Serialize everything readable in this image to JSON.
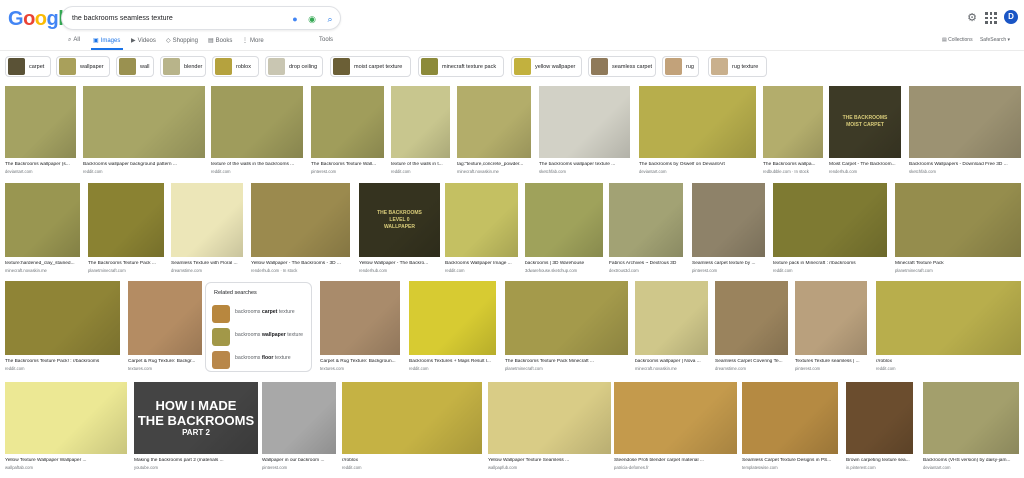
{
  "header": {
    "logo_letters": [
      "G",
      "o",
      "o",
      "g",
      "l",
      "e"
    ],
    "logo_colors": [
      "#4285f4",
      "#ea4335",
      "#fbbc05",
      "#4285f4",
      "#34a853",
      "#ea4335"
    ],
    "query": "the backrooms seamless texture",
    "avatar_letter": "D"
  },
  "tabs": [
    {
      "label": "All",
      "icon": "search-icon",
      "glyph": "⌕",
      "active": false
    },
    {
      "label": "Images",
      "icon": "images-icon",
      "glyph": "▣",
      "active": true
    },
    {
      "label": "Videos",
      "icon": "videos-icon",
      "glyph": "▶",
      "active": false
    },
    {
      "label": "Shopping",
      "icon": "shopping-icon",
      "glyph": "◇",
      "active": false
    },
    {
      "label": "Books",
      "icon": "books-icon",
      "glyph": "▤",
      "active": false
    },
    {
      "label": "More",
      "icon": "more-icon",
      "glyph": "⋮",
      "active": false
    },
    {
      "label": "Tools",
      "icon": "",
      "glyph": "",
      "active": false
    }
  ],
  "right_links": {
    "collections": "Collections",
    "safesearch": "SafeSearch ▾"
  },
  "chips": [
    {
      "label": "carpet",
      "color": "#5a5236"
    },
    {
      "label": "wallpaper",
      "color": "#a9a05b"
    },
    {
      "label": "wall",
      "color": "#9a9150"
    },
    {
      "label": "blender",
      "color": "#b8b48a"
    },
    {
      "label": "roblox",
      "color": "#b5a23e"
    },
    {
      "label": "drop ceiling",
      "color": "#c9c6b2"
    },
    {
      "label": "moist carpet texture",
      "color": "#6b5f36"
    },
    {
      "label": "minecraft texture pack",
      "color": "#8c8a3a"
    },
    {
      "label": "yellow wallpaper",
      "color": "#c2b13e"
    },
    {
      "label": "seamless carpet",
      "color": "#8f7a5a"
    },
    {
      "label": "rug",
      "color": "#c2a27a"
    },
    {
      "label": "rug texture",
      "color": "#c9b08d"
    }
  ],
  "results": [
    {
      "title": "The Backrooms wallpaper (s...",
      "source": "deviantart.com",
      "color": "#a4a262"
    },
    {
      "title": "Backrooms wallpaper background pattern ...",
      "source": "reddit.com",
      "color": "#a7a566"
    },
    {
      "title": "texture of the walls in the backrooms ...",
      "source": "reddit.com",
      "color": "#9f9c5c"
    },
    {
      "title": "The Backrooms Texture Wall...",
      "source": "pinterest.com",
      "color": "#a09d5b"
    },
    {
      "title": "texture of the walls in t...",
      "source": "reddit.com",
      "color": "#c8c68e"
    },
    {
      "title": "tag:\"texture,concrete_powder...",
      "source": "minecraft.novaskin.me",
      "color": "#b3ad6a"
    },
    {
      "title": "The backrooms wallpaper texture ...",
      "source": "sketchfab.com",
      "color": "#d2d1c6"
    },
    {
      "title": "The backrooms by Oswelf on DeviantArt",
      "source": "deviantart.com",
      "color": "#b7ae4c"
    },
    {
      "title": "The Backrooms wallpa...",
      "source": "redbubble.com · In stock",
      "color": "#b3ad6c"
    },
    {
      "title": "Moist Carpet - The Backroom...",
      "source": "renderhub.com",
      "color": "#3d3a26"
    },
    {
      "title": "Backrooms Wallpapers - Download Free 3D ...",
      "source": "sketchfab.com",
      "color": "#9c9272"
    },
    {
      "title": "texture:hardened_clay_stained...",
      "source": "minecraft.novaskin.me",
      "color": "#999651"
    },
    {
      "title": "The Backrooms Texture Pack ...",
      "source": "planetminecraft.com",
      "color": "#8a8232"
    },
    {
      "title": "Seamless Texture with Floral ...",
      "source": "dreamstime.com",
      "color": "#ece6b8"
    },
    {
      "title": "Yellow Wallpaper - The Backrooms - 3D ...",
      "source": "renderhub.com · In stock",
      "color": "#9b8a4e"
    },
    {
      "title": "Yellow Wallpaper - The Backro...",
      "source": "renderhub.com",
      "color": "#35331f"
    },
    {
      "title": "Backrooms Wallpaper Image ...",
      "source": "reddit.com",
      "color": "#c4c062"
    },
    {
      "title": "backrooms | 3D Warehouse",
      "source": "3dwarehouse.sketchup.com",
      "color": "#9fa25b"
    },
    {
      "title": "Fabrics Archives ~ Dextrous 3D",
      "source": "dextrous3d.com",
      "color": "#a2a274"
    },
    {
      "title": "Seamless carpet texture by ...",
      "source": "pinterest.com",
      "color": "#8e8269"
    },
    {
      "title": "texture pack in Minecraft : r/backrooms",
      "source": "reddit.com",
      "color": "#7e7a32"
    },
    {
      "title": "Minecraft Texture Pack",
      "source": "planetminecraft.com",
      "color": "#958d4d"
    },
    {
      "title": "The Backrooms Texture Pack! : r/backrooms",
      "source": "reddit.com",
      "color": "#8f8436"
    },
    {
      "title": "Carpet & Rug Texture: Backgr...",
      "source": "textures.com",
      "color": "#b48c63"
    },
    {
      "title": "Carpet & Rug Texture: Backgroun...",
      "source": "textures.com",
      "color": "#a98b6b"
    },
    {
      "title": "Backrooms Textures + Maps Result l...",
      "source": "reddit.com",
      "color": "#d7cb32"
    },
    {
      "title": "The Backrooms Texture Pack Minecraft ...",
      "source": "planetminecraft.com",
      "color": "#a49a4b"
    },
    {
      "title": "backrooms wallpaper | Nova ...",
      "source": "minecraft.novaskin.me",
      "color": "#cfc78a"
    },
    {
      "title": "Seamless Carpet Covering Te...",
      "source": "dreamstime.com",
      "color": "#9a835d"
    },
    {
      "title": "Textures Texture seamless | ...",
      "source": "pinterest.com",
      "color": "#b9a07d"
    },
    {
      "title": "r/roblox",
      "source": "reddit.com",
      "color": "#b8ae4c"
    },
    {
      "title": "Yellow Texture Wallpaper Wallpaper ...",
      "source": "wallpaftab.com",
      "color": "#ece894"
    },
    {
      "title": "Making the backrooms part 2 (materials ...",
      "source": "youtube.com",
      "color": "#444444"
    },
    {
      "title": "Wallpaper in our backroom ...",
      "source": "pinterest.com",
      "color": "#a8a8a8"
    },
    {
      "title": "r/roblox",
      "source": "reddit.com",
      "color": "#c5b244"
    },
    {
      "title": "Yellow Wallpaper Texture Seamless ...",
      "source": "wallpapfub.com",
      "color": "#d9cc86"
    },
    {
      "title": "Steendose Profi blender carpet material ...",
      "source": "patricia-defomes.fr",
      "color": "#c49a4c"
    },
    {
      "title": "Seamless Carpet Texture Designs in PS...",
      "source": "templateswise.com",
      "color": "#b58a42"
    },
    {
      "title": "Brown carpeting texture sea...",
      "source": "in.pinterest.com",
      "color": "#6b4d2e"
    },
    {
      "title": "Backrooms (VHS version) by daisy-jam...",
      "source": "deviantart.com",
      "color": "#a39f6c"
    }
  ],
  "thumb_text": {
    "level0": "THE BACKROOMS\nLEVEL 0\nWALLPAPER",
    "moist": "THE BACKROOMS\nMOIST CARPET",
    "howto_line1": "HOW I MADE",
    "howto_line2": "THE BACKROOMS",
    "howto_line3": "PART 2"
  },
  "related": {
    "heading": "Related searches",
    "items": [
      {
        "prefix": "backrooms ",
        "bold": "carpet",
        "suffix": " texture",
        "color": "#b8873e"
      },
      {
        "prefix": "backrooms ",
        "bold": "wallpaper",
        "suffix": " texture",
        "color": "#a29848"
      },
      {
        "prefix": "backrooms ",
        "bold": "floor",
        "suffix": " texture",
        "color": "#b8874a"
      }
    ]
  }
}
